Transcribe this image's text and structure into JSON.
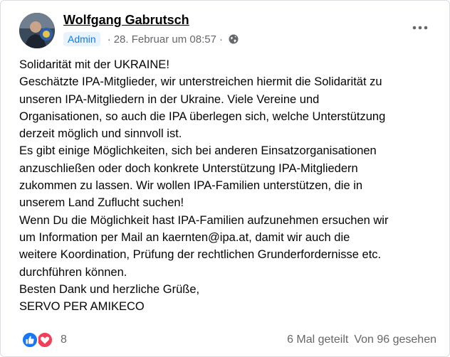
{
  "post": {
    "author": "Wolfgang Gabrutsch",
    "role_badge": "Admin",
    "separator": "·",
    "timestamp": "28. Februar um 08:57",
    "privacy_icon": "globe-icon",
    "more_icon": "more-options-icon"
  },
  "content": {
    "lines": [
      "Solidarität mit der UKRAINE!",
      "Geschätzte IPA-Mitglieder, wir unterstreichen hiermit die Solidarität zu",
      "unseren IPA-Mitgliedern in der Ukraine. Viele Vereine und",
      "Organisationen, so auch die IPA überlegen sich, welche Unterstützung",
      "derzeit möglich und sinnvoll ist.",
      "Es gibt einige Möglichkeiten, sich bei anderen Einsatzorganisationen",
      "anzuschließen oder doch konkrete Unterstützung IPA-Mitgliedern",
      "zukommen zu lassen. Wir wollen IPA-Familien unterstützen, die in",
      "unserem Land Zuflucht suchen!",
      "Wenn Du die Möglichkeit hast IPA-Familien aufzunehmen ersuchen wir",
      "um Information per Mail an kaernten@ipa.at, damit wir auch die",
      "weitere Koordination, Prüfung der rechtlichen Grunderfordernisse etc.",
      "durchführen können.",
      "Besten Dank und herzliche Grüße,",
      "SERVO PER AMIKECO"
    ]
  },
  "footer": {
    "reaction_icons": [
      "like-icon",
      "love-icon"
    ],
    "reaction_count": "8",
    "shares": "6 Mal geteilt",
    "views": "Von 96 gesehen"
  },
  "colors": {
    "like": "#1877f2",
    "love": "#f33e58",
    "secondary_text": "#65676b",
    "badge_bg": "#e7f3ff"
  }
}
